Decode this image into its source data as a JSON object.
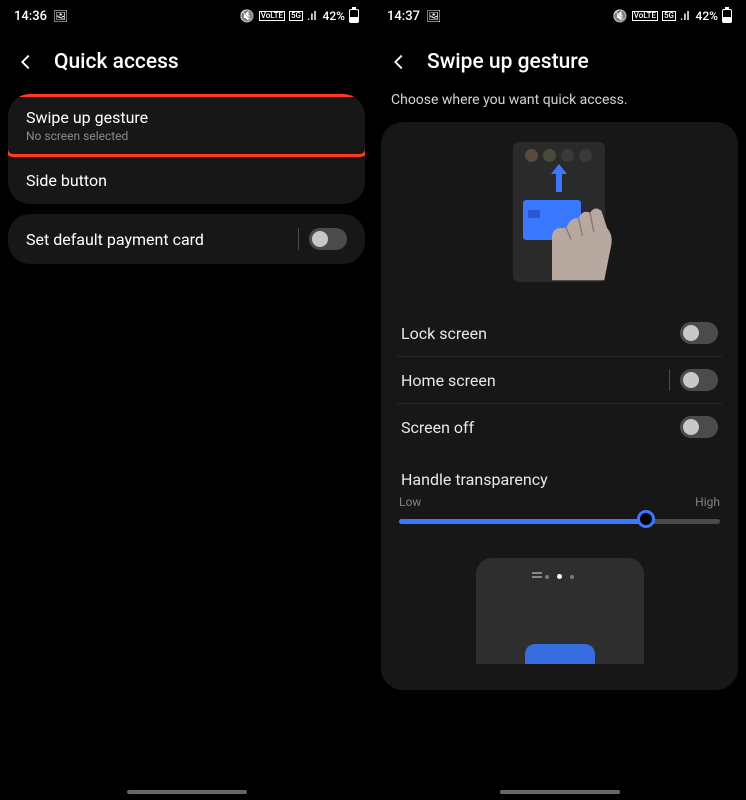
{
  "left": {
    "status": {
      "time": "14:36",
      "battery": "42%"
    },
    "header": "Quick access",
    "items": [
      {
        "label": "Swipe up gesture",
        "sub": "No screen selected"
      },
      {
        "label": "Side button"
      }
    ],
    "payment": {
      "label": "Set default payment card"
    }
  },
  "right": {
    "status": {
      "time": "14:37",
      "battery": "42%"
    },
    "header": "Swipe up gesture",
    "subtitle": "Choose where you want quick access.",
    "toggles": [
      {
        "label": "Lock screen",
        "on": false
      },
      {
        "label": "Home screen",
        "on": false,
        "divider": true
      },
      {
        "label": "Screen off",
        "on": false
      }
    ],
    "slider": {
      "label": "Handle transparency",
      "low": "Low",
      "high": "High",
      "value": 77
    }
  }
}
